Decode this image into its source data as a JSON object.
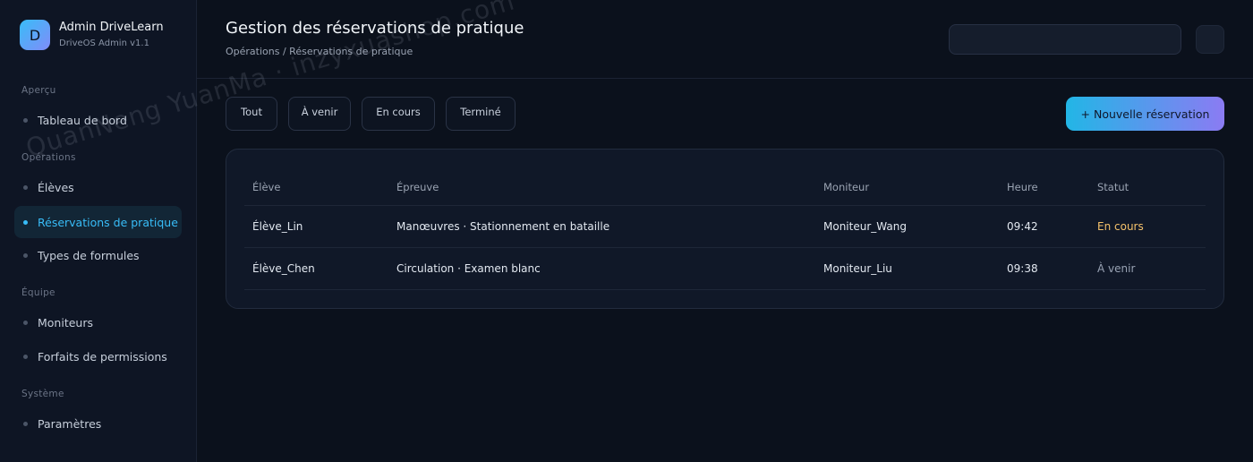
{
  "brand": {
    "logo_letter": "D",
    "title": "Admin DriveLearn",
    "subtitle": "DriveOS Admin v1.1"
  },
  "sidebar": {
    "sections": [
      {
        "label": "Aperçu"
      },
      {
        "label": "Opérations"
      },
      {
        "label": "Équipe"
      },
      {
        "label": "Système"
      }
    ],
    "items": [
      {
        "label": "Tableau de bord"
      },
      {
        "label": "Élèves"
      },
      {
        "label": "Réservations de pratique",
        "active": true
      },
      {
        "label": "Types de formules"
      },
      {
        "label": "Moniteurs"
      },
      {
        "label": "Forfaits de permissions"
      },
      {
        "label": "Paramètres"
      }
    ]
  },
  "header": {
    "title": "Gestion des réservations de pratique",
    "breadcrumb": "Opérations / Réservations de pratique",
    "search_value": ""
  },
  "filters": [
    "Tout",
    "À venir",
    "En cours",
    "Terminé"
  ],
  "new_button_label": "+ Nouvelle réservation",
  "table": {
    "columns": [
      "Élève",
      "Épreuve",
      "Moniteur",
      "Heure",
      "Statut"
    ],
    "rows": [
      {
        "student": "Élève_Lin",
        "exam": "Manœuvres · Stationnement en bataille",
        "instructor": "Moniteur_Wang",
        "time": "09:42",
        "status": "En cours"
      },
      {
        "student": "Élève_Chen",
        "exam": "Circulation · Examen blanc",
        "instructor": "Moniteur_Liu",
        "time": "09:38",
        "status": "À venir"
      }
    ]
  },
  "watermark": "QuanNeng YuanMa · inzyxuashop.com",
  "colors": {
    "accent": "#38bdf8",
    "status_running": "#f5c26b",
    "status_upcoming": "#98a2b3",
    "background": "#0b111c"
  }
}
